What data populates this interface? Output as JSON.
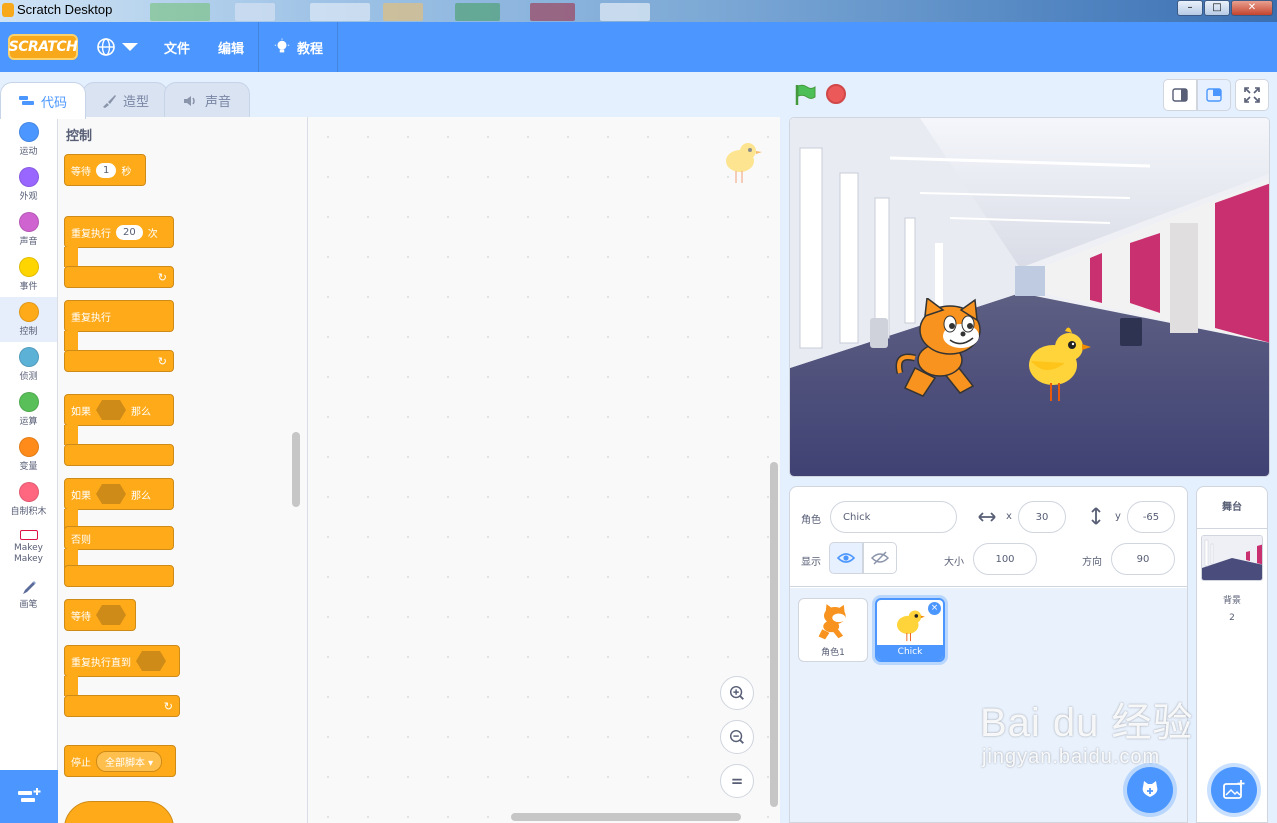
{
  "window": {
    "title": "Scratch Desktop",
    "minimize": "–",
    "maximize": "□",
    "close": "✕"
  },
  "menubar": {
    "logo": "SCRATCH",
    "file": "文件",
    "edit": "编辑",
    "tutorials": "教程"
  },
  "tabs": [
    {
      "label": "代码",
      "icon": "code-icon",
      "active": true
    },
    {
      "label": "造型",
      "icon": "brush-icon",
      "active": false
    },
    {
      "label": "声音",
      "icon": "speaker-icon",
      "active": false
    }
  ],
  "categories": [
    {
      "label": "运动",
      "color": "#4c97ff"
    },
    {
      "label": "外观",
      "color": "#9966ff"
    },
    {
      "label": "声音",
      "color": "#cf63cf"
    },
    {
      "label": "事件",
      "color": "#ffd500"
    },
    {
      "label": "控制",
      "color": "#ffab19",
      "active": true
    },
    {
      "label": "侦测",
      "color": "#5cb1d6"
    },
    {
      "label": "运算",
      "color": "#59c059"
    },
    {
      "label": "变量",
      "color": "#ff8c1a"
    },
    {
      "label": "自制积木",
      "color": "#ff6680"
    },
    {
      "label": "Makey Makey"
    },
    {
      "label": "画笔"
    }
  ],
  "palette": {
    "title": "控制",
    "blocks": {
      "wait": {
        "label": "等待",
        "value": "1",
        "unit": "秒"
      },
      "repeat": {
        "label": "重复执行",
        "value": "20",
        "unit": "次"
      },
      "forever": {
        "label": "重复执行"
      },
      "if_then": {
        "label": "如果",
        "then": "那么"
      },
      "if_else": {
        "label": "如果",
        "then": "那么",
        "else": "否则"
      },
      "wait_until": {
        "label": "等待"
      },
      "repeat_until": {
        "label": "重复执行直到"
      },
      "stop": {
        "label": "停止",
        "option": "全部脚本"
      }
    }
  },
  "zoom": {
    "in": "+",
    "out": "−",
    "reset": "="
  },
  "sprite_info": {
    "sprite_label": "角色",
    "sprite_name": "Chick",
    "x_label": "x",
    "x": "30",
    "y_label": "y",
    "y": "-65",
    "show_label": "显示",
    "size_label": "大小",
    "size": "100",
    "direction_label": "方向",
    "direction": "90"
  },
  "sprites": [
    {
      "name": "角色1",
      "selected": false
    },
    {
      "name": "Chick",
      "selected": true
    }
  ],
  "stage_pane": {
    "title": "舞台",
    "backdrop_label": "背景",
    "backdrop_count": "2"
  },
  "watermark": {
    "main": "Bai du 经验",
    "sub": "jingyan.baidu.com"
  },
  "colors": {
    "accent": "#4c97ff",
    "control": "#ffab19",
    "control_dark": "#cf8b17"
  }
}
